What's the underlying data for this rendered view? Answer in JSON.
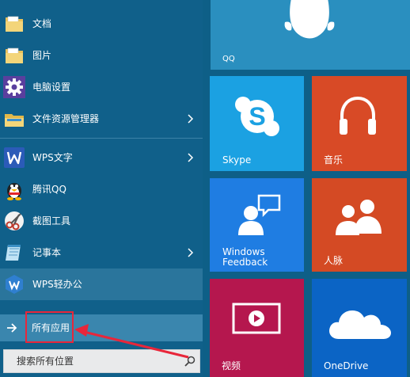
{
  "left": {
    "items": [
      {
        "label": "文档",
        "icon": "documents-folder-icon"
      },
      {
        "label": "图片",
        "icon": "pictures-folder-icon"
      },
      {
        "label": "电脑设置",
        "icon": "settings-gear-icon"
      },
      {
        "label": "文件资源管理器",
        "icon": "file-explorer-icon"
      },
      {
        "label": "WPS文字",
        "icon": "wps-writer-icon"
      },
      {
        "label": "腾讯QQ",
        "icon": "qq-penguin-icon"
      },
      {
        "label": "截图工具",
        "icon": "snipping-tool-icon"
      },
      {
        "label": "记事本",
        "icon": "notepad-icon"
      },
      {
        "label": "WPS轻办公",
        "icon": "wps-office-icon"
      }
    ],
    "all_apps_label": "所有应用",
    "search_placeholder": "搜索所有位置"
  },
  "tiles": {
    "qq": "QQ",
    "skype": "Skype",
    "music": "音乐",
    "feedback_line1": "Windows",
    "feedback_line2": "Feedback",
    "people": "人脉",
    "video": "视频",
    "onedrive": "OneDrive"
  },
  "colors": {
    "menu_bg": "#10608a",
    "skype": "#1ba1e2",
    "music": "#d84a26",
    "feedback": "#1f7de2",
    "people": "#d44a24",
    "video": "#b5174e",
    "onedrive": "#0b64c5",
    "highlight": "#e8263a"
  }
}
